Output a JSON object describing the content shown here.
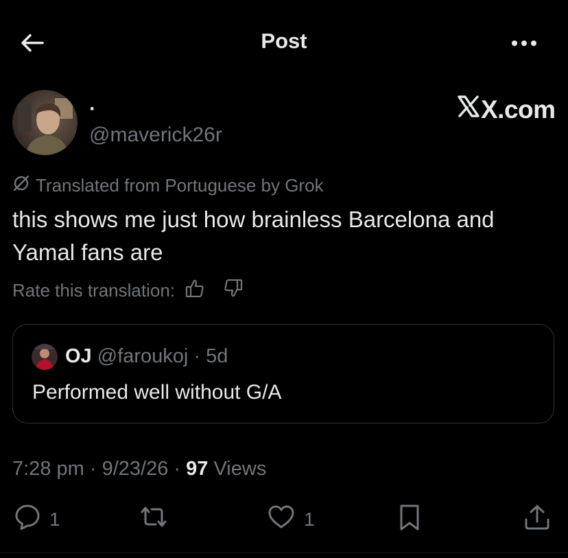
{
  "header": {
    "title": "Post"
  },
  "author": {
    "display_name": "·",
    "handle": "@maverick26r"
  },
  "watermark": "X.com",
  "translation": {
    "note": "Translated from Portuguese by Grok",
    "rate_label": "Rate this translation:"
  },
  "post": {
    "text": "this shows me just how brainless Barcelona and Yamal fans are"
  },
  "quoted_post": {
    "name": "OJ",
    "handle": "@faroukoj",
    "separator": "·",
    "age": "5d",
    "text": "Performed well without G/A"
  },
  "meta": {
    "time": "7:28 pm",
    "sep1": "·",
    "date": "9/23/26",
    "sep2": "·",
    "views_count": "97",
    "views_label": "Views"
  },
  "actions": {
    "reply_count": "1",
    "repost_count": "",
    "like_count": "1"
  },
  "colors": {
    "background": "#000000",
    "text_primary": "#e7e9ea",
    "text_secondary": "#71767b",
    "border": "#2f3336"
  },
  "icons": {
    "back": "arrow-left-icon",
    "more": "more-horizontal-icon",
    "grok": "grok-slash-icon",
    "thumbs_up": "thumbs-up-icon",
    "thumbs_down": "thumbs-down-icon",
    "reply": "reply-bubble-icon",
    "repost": "repost-arrows-icon",
    "like": "heart-icon",
    "bookmark": "bookmark-icon",
    "share": "share-upload-icon"
  }
}
